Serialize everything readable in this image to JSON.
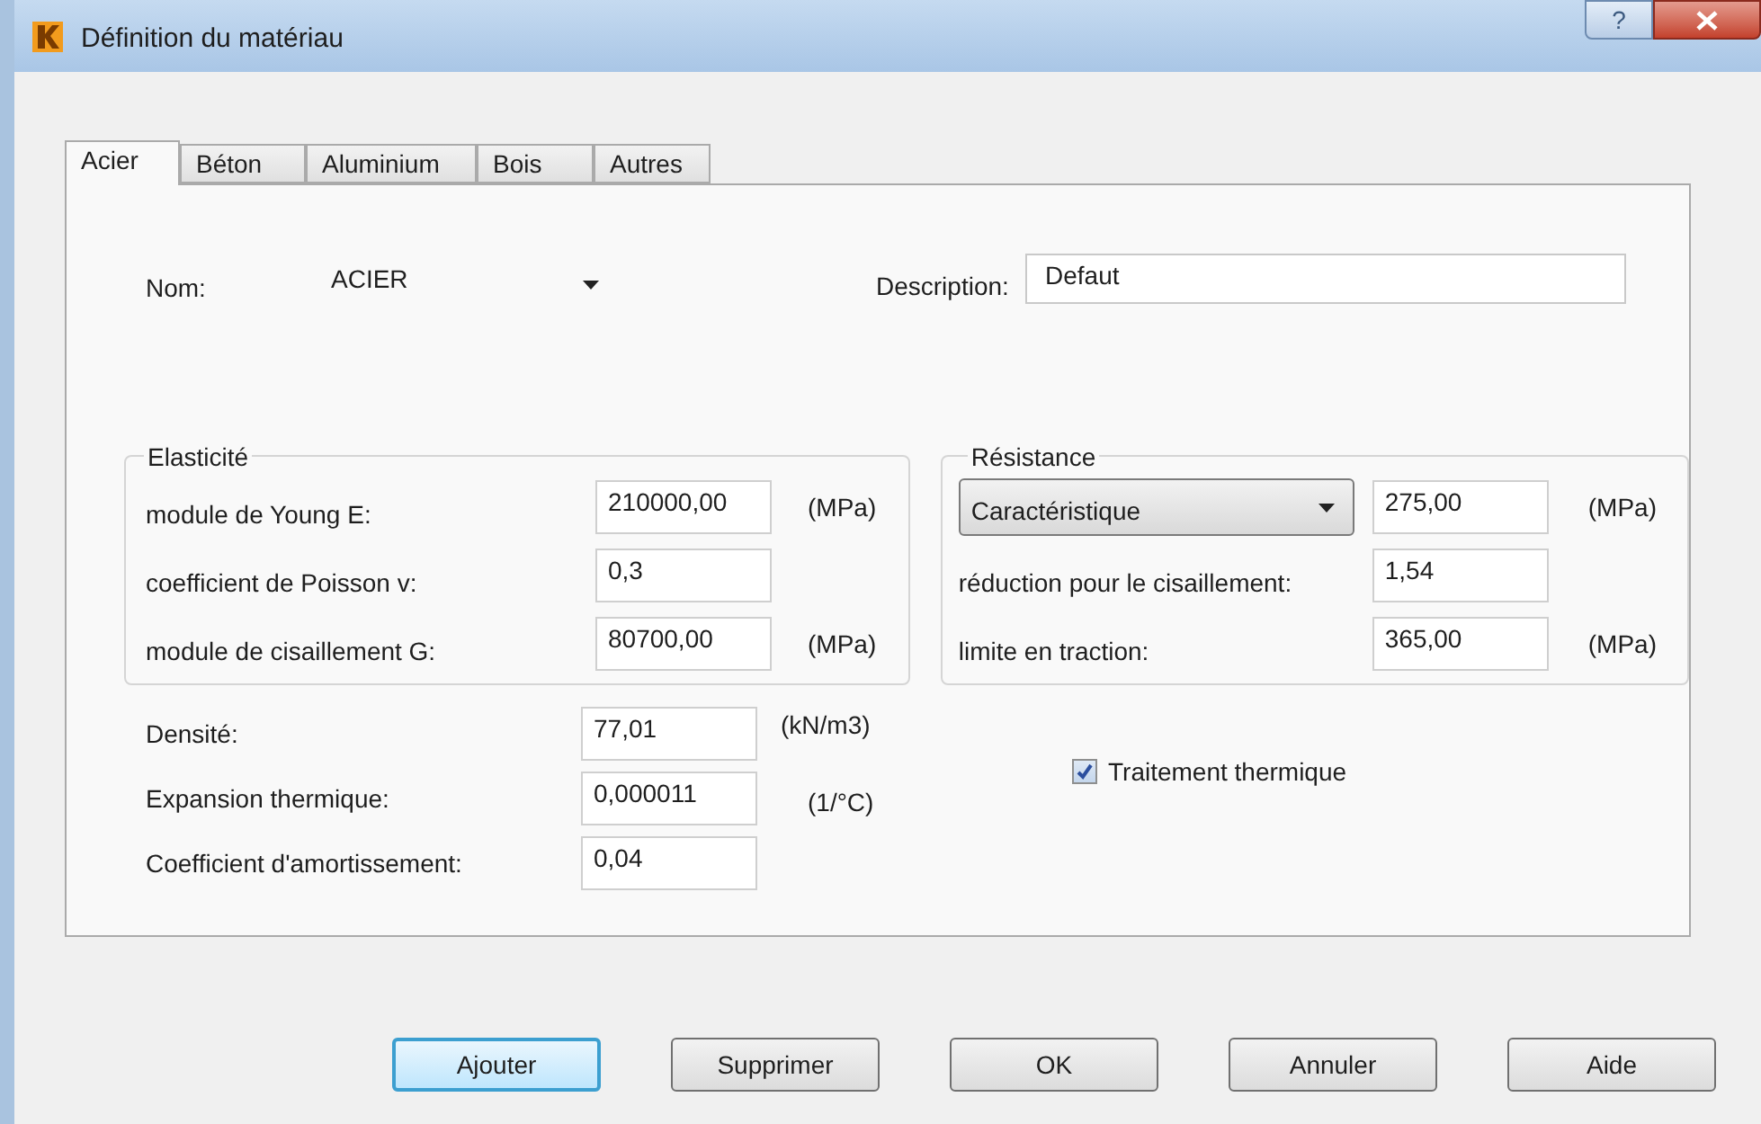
{
  "window": {
    "title": "Définition du matériau",
    "help_label": "?"
  },
  "tabs": [
    {
      "label": "Acier",
      "selected": true
    },
    {
      "label": "Béton",
      "selected": false
    },
    {
      "label": "Aluminium",
      "selected": false
    },
    {
      "label": "Bois",
      "selected": false
    },
    {
      "label": "Autres",
      "selected": false
    }
  ],
  "nom": {
    "label": "Nom:",
    "value": "ACIER"
  },
  "description": {
    "label": "Description:",
    "value": "Defaut"
  },
  "elasticite": {
    "title": "Elasticité",
    "rows": [
      {
        "label": "module de Young E:",
        "value": "210000,00",
        "unit": "(MPa)"
      },
      {
        "label": "coefficient de Poisson v:",
        "value": "0,3"
      },
      {
        "label": "module de cisaillement G:",
        "value": "80700,00",
        "unit": "(MPa)"
      }
    ]
  },
  "resistance": {
    "title": "Résistance",
    "mode": "Caractéristique",
    "rows": [
      {
        "kind": "combo",
        "value": "275,00",
        "unit": "(MPa)"
      },
      {
        "kind": "label",
        "label": "réduction pour le cisaillement:",
        "value": "1,54"
      },
      {
        "kind": "label",
        "label": "limite en traction:",
        "value": "365,00",
        "unit": "(MPa)"
      }
    ]
  },
  "properties": [
    {
      "label": "Densité:",
      "value": "77,01",
      "unit": "(kN/m3)"
    },
    {
      "label": "Expansion thermique:",
      "value": "0,000011",
      "unit": "(1/°C)"
    },
    {
      "label": "Coefficient d'amortissement:",
      "value": "0,04"
    }
  ],
  "heat_treatment": {
    "label": "Traitement thermique",
    "checked": true
  },
  "buttons": [
    {
      "label": "Ajouter",
      "focused": true
    },
    {
      "label": "Supprimer",
      "focused": false
    },
    {
      "label": "OK",
      "focused": false
    },
    {
      "label": "Annuler",
      "focused": false
    },
    {
      "label": "Aide",
      "focused": false
    }
  ]
}
